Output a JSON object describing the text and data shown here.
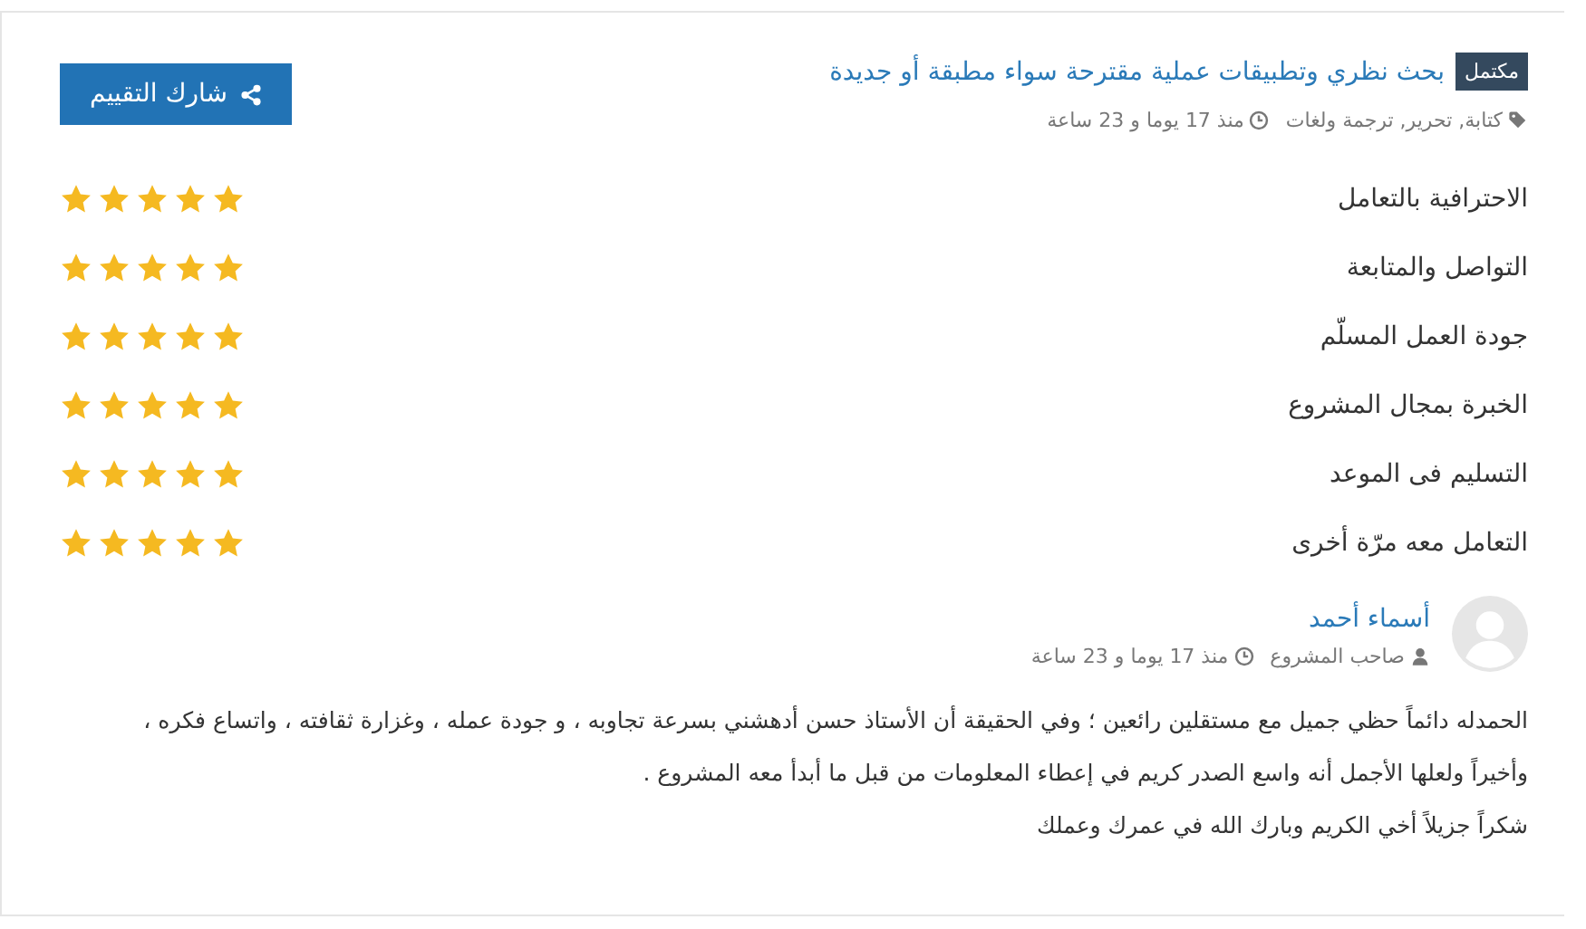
{
  "project": {
    "status_badge": "مكتمل",
    "title": "بحث نظري وتطبيقات عملية مقترحة سواء مطبقة أو جديدة",
    "tags": "كتابة, تحرير, ترجمة ولغات",
    "time": "منذ 17 يوما و 23 ساعة"
  },
  "share_button": "شارك التقييم",
  "ratings": [
    {
      "label": "الاحترافية بالتعامل",
      "stars": 5
    },
    {
      "label": "التواصل والمتابعة",
      "stars": 5
    },
    {
      "label": "جودة العمل المسلّم",
      "stars": 5
    },
    {
      "label": "الخبرة بمجال المشروع",
      "stars": 5
    },
    {
      "label": "التسليم فى الموعد",
      "stars": 5
    },
    {
      "label": "التعامل معه مرّة أخرى",
      "stars": 5
    }
  ],
  "review": {
    "author": "أسماء أحمد",
    "role": "صاحب المشروع",
    "time": "منذ 17 يوما و 23 ساعة",
    "paragraphs": [
      "الحمدله دائماً حظي جميل مع مستقلين رائعين ؛ وفي الحقيقة أن الأستاذ حسن أدهشني بسرعة تجاوبه ، و جودة عمله ، وغزارة ثقافته ، واتساع فكره ، وأخيراً ولعلها الأجمل أنه واسع الصدر كريم في إعطاء المعلومات من قبل ما أبدأ معه المشروع .",
      "شكراً جزيلاً أخي الكريم وبارك الله في عمرك وعملك"
    ]
  }
}
